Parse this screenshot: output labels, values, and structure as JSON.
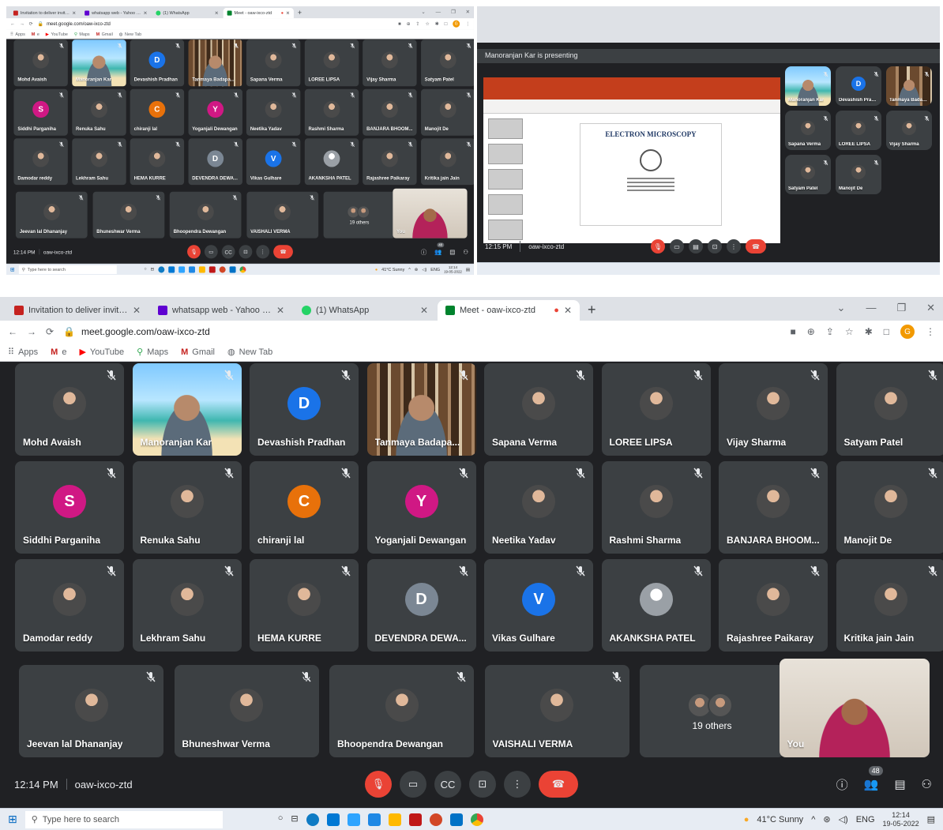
{
  "browser": {
    "tabs": [
      {
        "title": "Invitation to deliver invited talk -",
        "color": "#c5221f"
      },
      {
        "title": "whatsapp web - Yahoo India Sea",
        "color": "#5f01d1"
      },
      {
        "title": "(1) WhatsApp",
        "color": "#25d366"
      },
      {
        "title": "Meet - oaw-ixco-ztd",
        "color": "#00832d"
      }
    ],
    "url": "meet.google.com/oaw-ixco-ztd",
    "bookmarks": [
      "Apps",
      "e",
      "YouTube",
      "Maps",
      "Gmail",
      "New Tab"
    ],
    "profile_initial": "G"
  },
  "meeting": {
    "time": "12:14 PM",
    "code": "oaw-ixco-ztd",
    "participant_count": "48",
    "others_label": "19 others",
    "self_label": "You"
  },
  "participants": [
    {
      "name": "Mohd Avaish",
      "type": "photo"
    },
    {
      "name": "Manoranjan Kar",
      "type": "beach"
    },
    {
      "name": "Devashish Pradhan",
      "type": "letter",
      "letter": "D",
      "color": "#1a73e8"
    },
    {
      "name": "Tanmaya Badapa...",
      "type": "books"
    },
    {
      "name": "Sapana Verma",
      "type": "photo"
    },
    {
      "name": "LOREE LIPSA",
      "type": "photo"
    },
    {
      "name": "Vijay Sharma",
      "type": "photo"
    },
    {
      "name": "Satyam Patel",
      "type": "photo"
    },
    {
      "name": "Siddhi Parganiha",
      "type": "letter",
      "letter": "S",
      "color": "#d01884"
    },
    {
      "name": "Renuka Sahu",
      "type": "photo"
    },
    {
      "name": "chiranji lal",
      "type": "letter",
      "letter": "C",
      "color": "#e8710a"
    },
    {
      "name": "Yoganjali Dewangan",
      "type": "letter",
      "letter": "Y",
      "color": "#d01884"
    },
    {
      "name": "Neetika Yadav",
      "type": "photo"
    },
    {
      "name": "Rashmi Sharma",
      "type": "photo"
    },
    {
      "name": "BANJARA BHOOM...",
      "type": "photo"
    },
    {
      "name": "Manojit De",
      "type": "photo"
    },
    {
      "name": "Damodar reddy",
      "type": "photo"
    },
    {
      "name": "Lekhram Sahu",
      "type": "photo"
    },
    {
      "name": "HEMA KURRE",
      "type": "photo"
    },
    {
      "name": "DEVENDRA DEWA...",
      "type": "letter",
      "letter": "D",
      "color": "#7b8794"
    },
    {
      "name": "Vikas Gulhare",
      "type": "letter",
      "letter": "V",
      "color": "#1a73e8"
    },
    {
      "name": "AKANKSHA PATEL",
      "type": "letter",
      "letter": "",
      "color": "#9aa0a6"
    },
    {
      "name": "Rajashree Paikaray",
      "type": "photo"
    },
    {
      "name": "Kritika jain Jain",
      "type": "photo"
    },
    {
      "name": "Jeevan lal Dhananjay",
      "type": "photo"
    },
    {
      "name": "Bhuneshwar Verma",
      "type": "photo"
    },
    {
      "name": "Bhoopendra Dewangan",
      "type": "photo"
    },
    {
      "name": "VAISHALI VERMA",
      "type": "photo"
    }
  ],
  "presentation": {
    "banner": "Manoranjan Kar is presenting",
    "slide_title": "ELECTRON MICROSCOPY",
    "time": "12:15 PM",
    "code": "oaw-ixco-ztd"
  },
  "taskbar": {
    "search_placeholder": "Type here to search",
    "weather": "41°C Sunny",
    "lang": "ENG",
    "time": "12:14",
    "date": "19-05-2022"
  }
}
